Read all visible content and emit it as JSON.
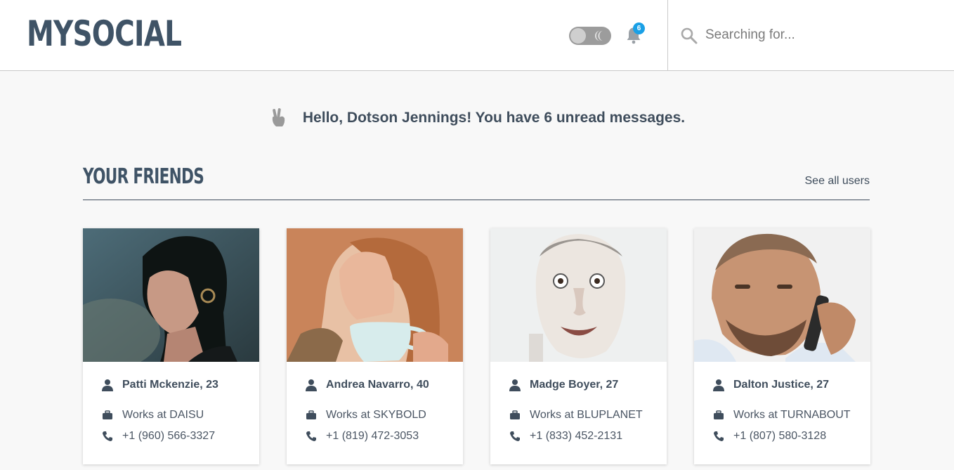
{
  "header": {
    "logo": "MYSOCIAL",
    "notification_count": "6",
    "search": {
      "placeholder": "Searching for...",
      "value": ""
    }
  },
  "greeting": {
    "text": "Hello, Dotson Jennings! You have 6 unread messages."
  },
  "friends_section": {
    "title": "Your friends",
    "see_all_label": "See all users",
    "friends": [
      {
        "name": "Patti Mckenzie, 23",
        "work": "Works at DAISU",
        "phone": "+1 (960) 566-3327"
      },
      {
        "name": "Andrea Navarro, 40",
        "work": "Works at SKYBOLD",
        "phone": "+1 (819) 472-3053"
      },
      {
        "name": "Madge Boyer, 27",
        "work": "Works at BLUPLANET",
        "phone": "+1 (833) 452-2131"
      },
      {
        "name": "Dalton Justice, 27",
        "work": "Works at TURNABOUT",
        "phone": "+1 (807) 580-3128"
      }
    ]
  },
  "icons": {
    "theme_toggle": "moon-icon",
    "notifications": "bell-icon",
    "search": "search-icon",
    "greeting": "peace-hand-icon",
    "name": "user-icon",
    "work": "briefcase-icon",
    "phone": "phone-icon"
  },
  "colors": {
    "brand": "#3f5366",
    "badge": "#1aa0e6",
    "text": "#3f4d5c",
    "background": "#f8f8f8"
  }
}
